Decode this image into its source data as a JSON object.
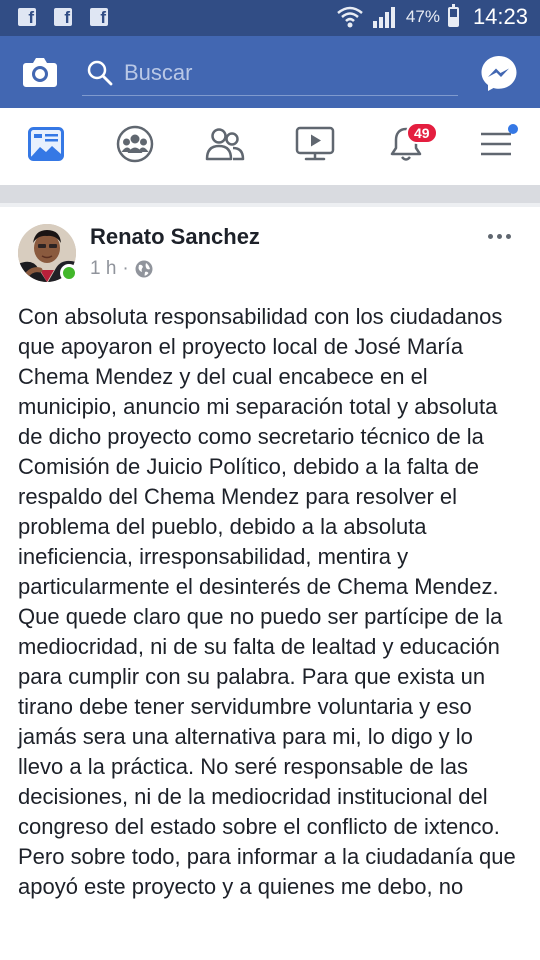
{
  "status_bar": {
    "battery_percent": "47%",
    "battery_level": 0.47,
    "time": "14:23",
    "notification_icons": [
      "facebook-icon",
      "facebook-icon",
      "facebook-icon"
    ],
    "indicator_icons": [
      "wifi-icon",
      "signal-icon",
      "battery-icon"
    ]
  },
  "header": {
    "search_placeholder": "Buscar",
    "left_icon": "camera-icon",
    "right_icon": "messenger-icon",
    "accent_color": "#4267b2"
  },
  "navbar": {
    "items": [
      {
        "icon": "news-feed-icon",
        "active": true
      },
      {
        "icon": "groups-icon",
        "active": false
      },
      {
        "icon": "friends-icon",
        "active": false
      },
      {
        "icon": "watch-icon",
        "active": false
      },
      {
        "icon": "notifications-icon",
        "active": false,
        "badge": "49"
      },
      {
        "icon": "menu-icon",
        "active": false,
        "dot": true
      }
    ]
  },
  "post": {
    "author": "Renato Sanchez",
    "time": "1 h",
    "separator": "·",
    "privacy_icon": "globe-icon",
    "online": true,
    "text": "Con absoluta responsabilidad con los ciudadanos que apoyaron el proyecto local de José María Chema Mendez y del cual encabece en el municipio, anuncio mi separación total y absoluta de dicho proyecto como secretario técnico de la Comisión de Juicio Político, debido a la falta de respaldo del Chema Mendez para resolver el problema del pueblo, debido a la absoluta ineficiencia, irresponsabilidad, mentira y particularmente el desinterés de Chema Mendez. Que quede claro que no puedo ser partícipe de la mediocridad, ni de su falta de lealtad y educación para cumplir con su palabra. Para que exista un tirano debe tener servidumbre voluntaria y eso jamás sera una alternativa para mi, lo digo y lo llevo a la práctica. No seré responsable de las decisiones, ni de la mediocridad institucional del congreso del estado sobre el conflicto de ixtenco. Pero sobre todo, para informar a la ciudadanía que apoyó este proyecto y a quienes me debo, no"
  }
}
